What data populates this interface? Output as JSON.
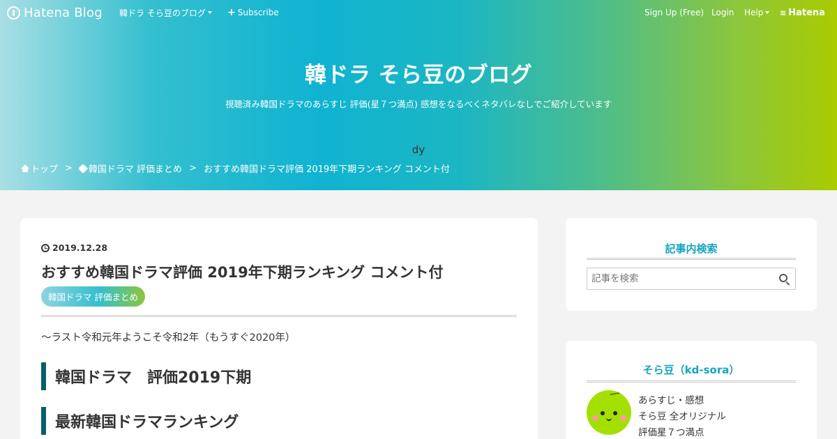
{
  "topbar": {
    "logo_text": "Hatena Blog",
    "blog_menu": "韓ドラ そら豆のブログ",
    "subscribe": "Subscribe",
    "signup": "Sign Up (Free)",
    "login": "Login",
    "help": "Help",
    "hatena": "Hatena"
  },
  "header": {
    "title": "韓ドラ そら豆のブログ",
    "description": "視聴済み韓国ドラマのあらすじ 評価(星７つ満点) 感想をなるべくネタバレなしでご紹介しています",
    "extra_text": "dy"
  },
  "breadcrumb": {
    "home": "トップ",
    "separator": ">",
    "category": "韓国ドラマ 評価まとめ",
    "current": "おすすめ韓国ドラマ評価 2019年下期ランキング コメント付"
  },
  "entry": {
    "date": "2019.12.28",
    "title": "おすすめ韓国ドラマ評価 2019年下期ランキング コメント付",
    "category": "韓国ドラマ 評価まとめ",
    "intro": "～ラスト令和元年ようこそ令和2年（もうすぐ2020年）",
    "headings": [
      "韓国ドラマ　評価2019下期",
      "最新韓国ドラマランキング"
    ]
  },
  "sidebar": {
    "search": {
      "title": "記事内検索",
      "placeholder": "記事を検索"
    },
    "profile": {
      "title": "そら豆（kd-sora）",
      "lines": [
        "あらすじ・感想",
        "そら豆 全オリジナル",
        "評価星７つ満点"
      ]
    }
  },
  "colors": {
    "accent_heading": "#15a4c0",
    "h3_border": "#075f68",
    "avatar": "#a3e000"
  }
}
